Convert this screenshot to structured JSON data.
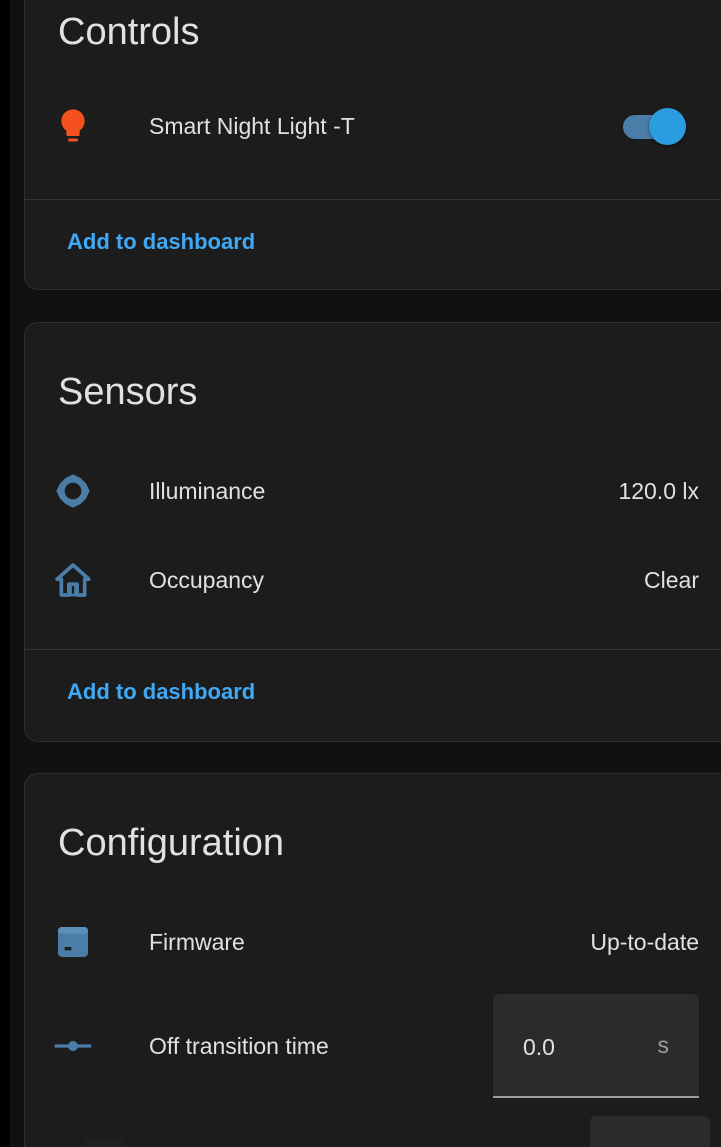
{
  "colors": {
    "accent": "#3fa9f5",
    "icon_blue": "#4a7ea8",
    "light_icon": "#f4511e",
    "card_bg": "#1c1c1c",
    "page_bg": "#111111"
  },
  "controls": {
    "title": "Controls",
    "items": [
      {
        "icon": "lightbulb-icon",
        "label": "Smart Night Light -T",
        "state": "on"
      }
    ],
    "add_label": "Add to dashboard"
  },
  "sensors": {
    "title": "Sensors",
    "items": [
      {
        "icon": "brightness-icon",
        "label": "Illuminance",
        "value": "120.0 lx"
      },
      {
        "icon": "home-icon",
        "label": "Occupancy",
        "value": "Clear"
      }
    ],
    "add_label": "Add to dashboard"
  },
  "configuration": {
    "title": "Configuration",
    "items": [
      {
        "icon": "firmware-icon",
        "label": "Firmware",
        "value": "Up-to-date"
      },
      {
        "icon": "transition-icon",
        "label": "Off transition time",
        "input_value": "0.0",
        "unit": "s"
      }
    ]
  }
}
